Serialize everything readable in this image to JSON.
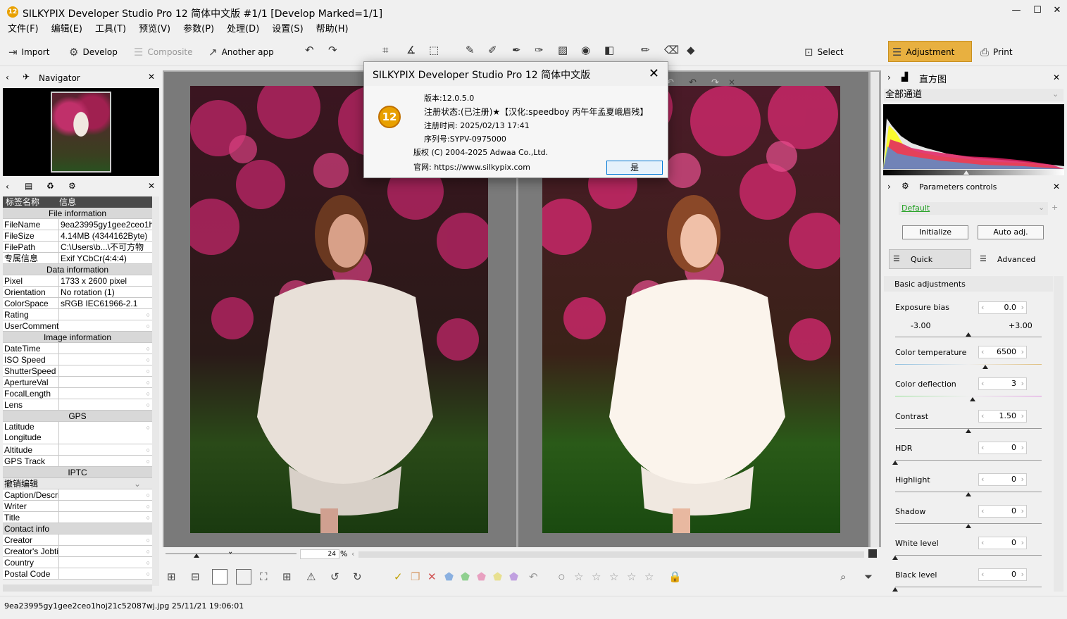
{
  "window": {
    "title": "SILKYPIX Developer Studio Pro 12 简体中文版   #1/1 [Develop Marked=1/1]",
    "logo": "12"
  },
  "menu": [
    "文件(F)",
    "编辑(E)",
    "工具(T)",
    "预览(V)",
    "参数(P)",
    "处理(D)",
    "设置(S)",
    "帮助(H)"
  ],
  "toolbar": {
    "import": "Import",
    "develop": "Develop",
    "composite": "Composite",
    "another_app": "Another app",
    "select": "Select",
    "adjustment": "Adjustment",
    "print": "Print"
  },
  "navigator": {
    "title": "Navigator"
  },
  "info_table": {
    "col_key": "标签名称",
    "col_value": "信息",
    "file_information": "File information",
    "filename_k": "FileName",
    "filename_v": "9ea23995gy1gee2ceo1hc",
    "filesize_k": "FileSize",
    "filesize_v": "4.14MB (4344162Byte)",
    "filepath_k": "FilePath",
    "filepath_v": "C:\\Users\\b...\\不可方物",
    "special_k": "专属信息",
    "special_v": "Exif YCbCr(4:4:4)",
    "data_information": "Data information",
    "pixel_k": "Pixel",
    "pixel_v": "1733 x 2600 pixel",
    "orient_k": "Orientation",
    "orient_v": "No rotation (1)",
    "color_k": "ColorSpace",
    "color_v": "sRGB IEC61966-2.1",
    "rating_k": "Rating",
    "usercomment_k": "UserComment",
    "image_information": "Image information",
    "datetime_k": "DateTime",
    "iso_k": "ISO Speed",
    "shutter_k": "ShutterSpeed",
    "aperture_k": "ApertureVal",
    "focal_k": "FocalLength",
    "lens_k": "Lens",
    "gps": "GPS",
    "lat_k": "Latitude",
    "lon_k": "Longitude",
    "alt_k": "Altitude",
    "gpstrack_k": "GPS Track",
    "iptc": "IPTC",
    "undo_edit": "撤销编辑",
    "caption_k": "Caption/Descri",
    "writer_k": "Writer",
    "title_k": "Title",
    "contact_info": "Contact info",
    "creator_k": "Creator",
    "creator_job_k": "Creator's Jobtit",
    "country_k": "Country",
    "postal_k": "Postal Code"
  },
  "histogram": {
    "title": "直方图",
    "channel": "全部通道"
  },
  "params": {
    "title": "Parameters controls",
    "preset": "Default",
    "initialize": "Initialize",
    "auto_adj": "Auto adj.",
    "quick": "Quick",
    "advanced": "Advanced",
    "basic": "Basic adjustments",
    "exposure_label": "Exposure bias",
    "exposure_value": "0.0",
    "exposure_min": "-3.00",
    "exposure_max": "+3.00",
    "colortemp_label": "Color temperature",
    "colortemp_value": "6500",
    "colordef_label": "Color deflection",
    "colordef_value": "3",
    "contrast_label": "Contrast",
    "contrast_value": "1.50",
    "hdr_label": "HDR",
    "hdr_value": "0",
    "highlight_label": "Highlight",
    "highlight_value": "0",
    "shadow_label": "Shadow",
    "shadow_value": "0",
    "white_label": "White level",
    "white_value": "0",
    "black_label": "Black level",
    "black_value": "0"
  },
  "zoom": {
    "value": "24",
    "unit": "%"
  },
  "status": {
    "text": "9ea23995gy1gee2ceo1hoj21c52087wj.jpg 25/11/21 19:06:01"
  },
  "dialog": {
    "title": "SILKYPIX Developer Studio Pro 12 简体中文版",
    "version": "版本:12.0.5.0",
    "reg_status": "注册状态:(已注册)★【汉化:speedboy 丙午年孟夏峨眉残】",
    "reg_time": "注册时间: 2025/02/13 17:41",
    "serial": "序列号:SYPV-0975000",
    "copyright": "版权 (C) 2004-2025 Adwaa Co.,Ltd.",
    "website": "官网: https://www.silkypix.com",
    "ok": "是"
  },
  "colors": {
    "accent": "#e8b040",
    "nav_bg": "#000000",
    "green_text": "#20a020"
  }
}
